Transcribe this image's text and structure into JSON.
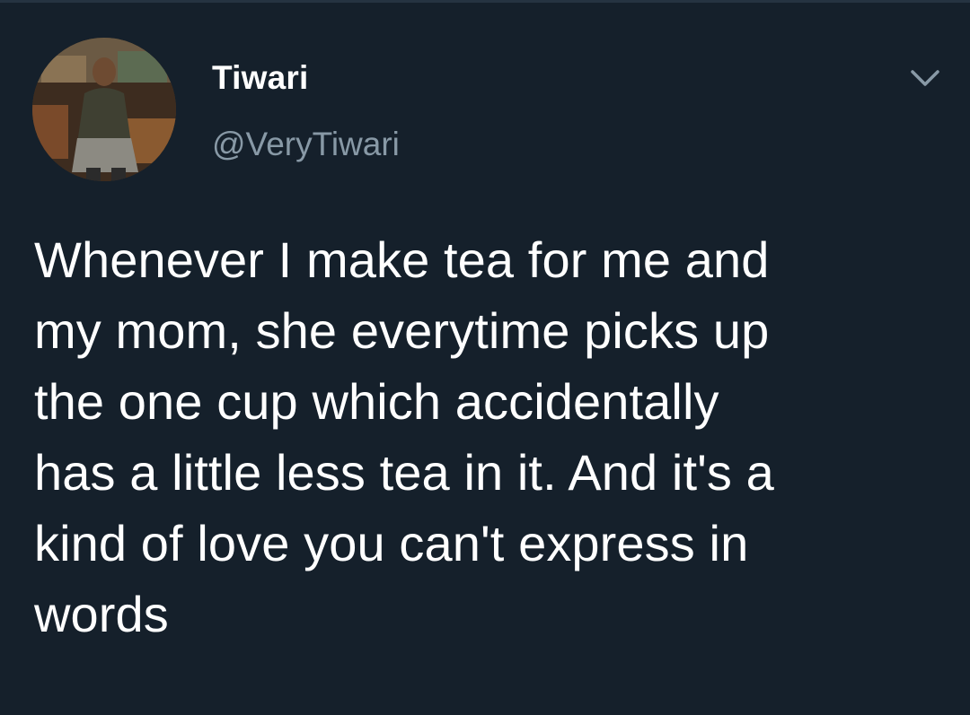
{
  "tweet": {
    "display_name": "Tiwari",
    "handle": "@VeryTiwari",
    "text": "Whenever I make tea for me and\nmy mom, she everytime picks up\nthe one cup which accidentally\nhas a little less tea in it. And it's a\nkind of love you can't express in\nwords"
  },
  "icons": {
    "avatar": "profile-photo",
    "menu": "chevron-down-icon"
  },
  "colors": {
    "background": "#15202b",
    "primary_text": "#ffffff",
    "secondary_text": "#8899a6"
  }
}
